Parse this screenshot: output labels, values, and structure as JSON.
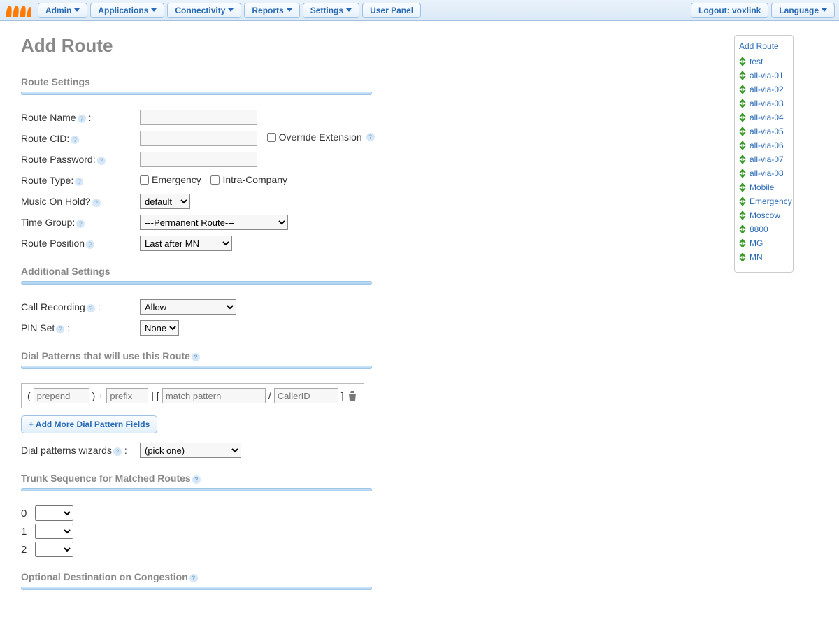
{
  "menubar": {
    "items_left": [
      "Admin",
      "Applications",
      "Connectivity",
      "Reports",
      "Settings",
      "User Panel"
    ],
    "logout": "Logout: voxlink",
    "language": "Language"
  },
  "page": {
    "title": "Add Route"
  },
  "sections": {
    "route_settings": "Route Settings",
    "additional": "Additional Settings",
    "dial_patterns": "Dial Patterns that will use this Route",
    "trunk_seq": "Trunk Sequence for Matched Routes",
    "congestion": "Optional Destination on Congestion"
  },
  "labels": {
    "route_name": "Route Name",
    "route_cid": "Route CID:",
    "override_ext": "Override Extension",
    "route_password": "Route Password:",
    "route_type": "Route Type:",
    "emergency": "Emergency",
    "intra_company": "Intra-Company",
    "moh": "Music On Hold?",
    "time_group": "Time Group:",
    "route_position": "Route Position",
    "call_recording": "Call Recording",
    "pin_set": "PIN Set",
    "add_more_dial": "+ Add More Dial Pattern Fields",
    "dial_wizards": "Dial patterns wizards"
  },
  "values": {
    "moh": "default",
    "time_group": "---Permanent Route---",
    "route_position": "Last after MN",
    "call_recording": "Allow",
    "pin_set": "None",
    "dial_wizard": "(pick one)"
  },
  "dial_placeholders": {
    "prepend": "prepend",
    "prefix": "prefix",
    "match": "match pattern",
    "callerid": "CallerID"
  },
  "trunks": [
    "0",
    "1",
    "2"
  ],
  "sidebar": {
    "title": "Add Route",
    "items": [
      "test",
      "all-via-01",
      "all-via-02",
      "all-via-03",
      "all-via-04",
      "all-via-05",
      "all-via-06",
      "all-via-07",
      "all-via-08",
      "Mobile",
      "Emergency",
      "Moscow",
      "8800",
      "MG",
      "MN"
    ]
  }
}
